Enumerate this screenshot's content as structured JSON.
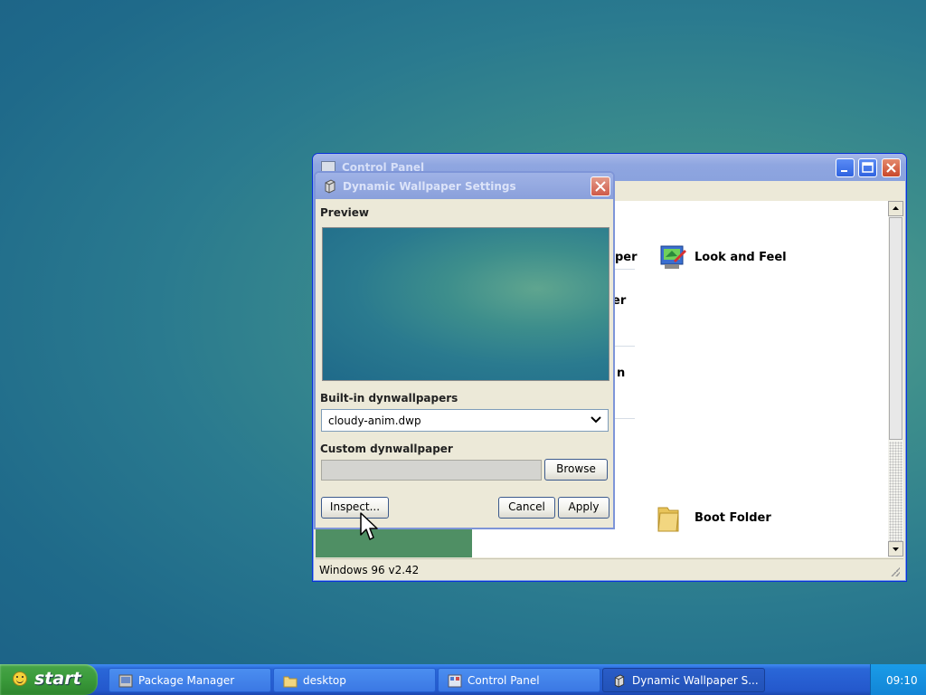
{
  "control_panel": {
    "title": "Control Panel",
    "items": {
      "look_and_feel": "Look and Feel",
      "boot_folder": "Boot Folder",
      "partial_1": "per",
      "partial_2": "er",
      "partial_3": "n"
    },
    "status": "Windows 96 v2.42",
    "buttons": {
      "minimize": "_",
      "maximize": "□",
      "close": "✕"
    }
  },
  "dialog": {
    "title": "Dynamic Wallpaper Settings",
    "close_glyph": "✕",
    "preview_label": "Preview",
    "builtin_label": "Built-in dynwallpapers",
    "builtin_selected": "cloudy-anim.dwp",
    "custom_label": "Custom dynwallpaper",
    "custom_value": "",
    "buttons": {
      "browse": "Browse",
      "inspect": "Inspect...",
      "cancel": "Cancel",
      "apply": "Apply"
    }
  },
  "taskbar": {
    "start_label": "start",
    "tasks": [
      {
        "label": "Package Manager",
        "icon": "package-icon"
      },
      {
        "label": "desktop",
        "icon": "folder-icon"
      },
      {
        "label": "Control Panel",
        "icon": "control-panel-icon"
      },
      {
        "label": "Dynamic Wallpaper S...",
        "icon": "wallpaper-icon"
      }
    ],
    "clock": "09:10"
  }
}
